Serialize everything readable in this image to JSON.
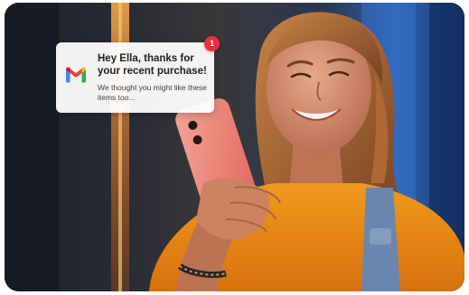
{
  "notification": {
    "app_icon": "gmail-icon",
    "title": "Hey Ella, thanks for your recent purchase!",
    "body": "We thought you might like these items too...",
    "badge_count": "1"
  },
  "colors": {
    "badge": "#e8303f",
    "shirt": "#f7921e",
    "phone": "#ff8a7a",
    "background": "#1a2230"
  }
}
